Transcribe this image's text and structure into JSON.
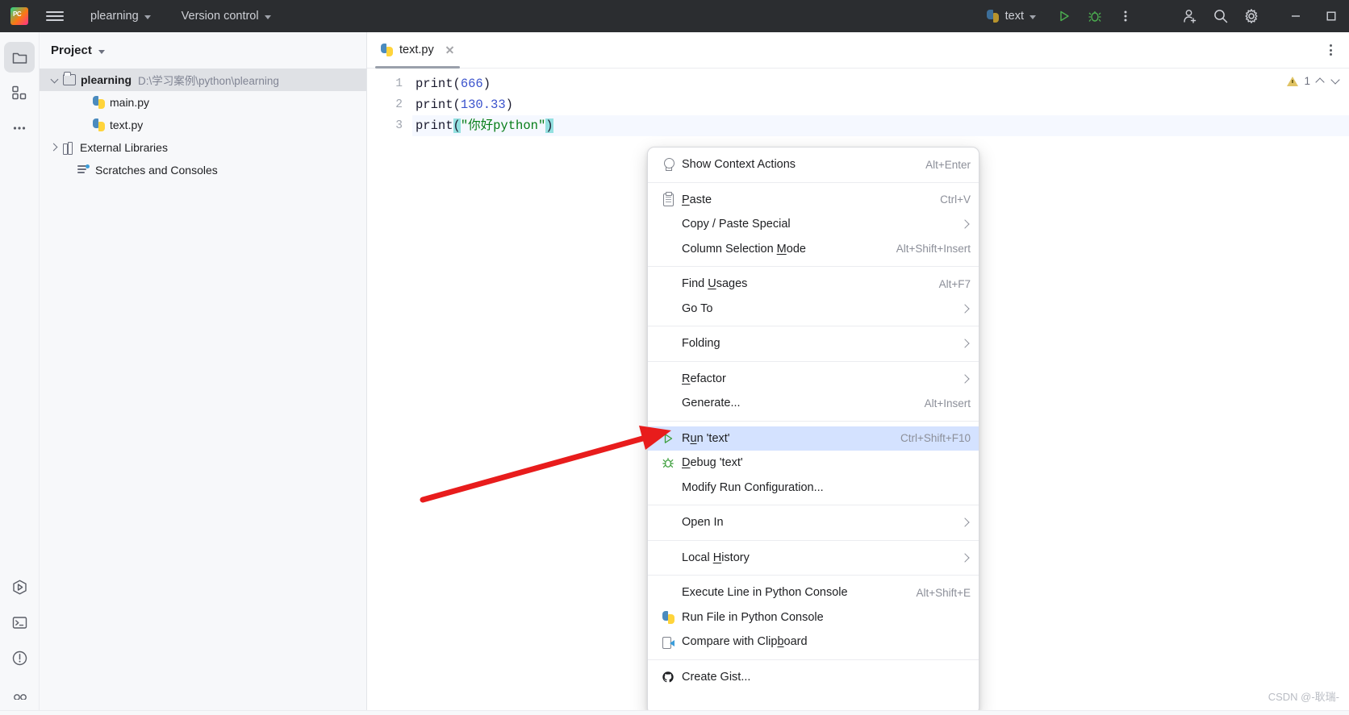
{
  "titlebar": {
    "logo": "pycharm-logo",
    "menu_icon": "hamburger-icon",
    "project_name": "plearning",
    "version_control": "Version control",
    "run_config_name": "text",
    "run_icon": "run-icon",
    "debug_icon": "debug-icon",
    "more_icon": "more-vertical-icon",
    "account_icon": "add-user-icon",
    "search_icon": "search-icon",
    "settings_icon": "gear-icon",
    "minimize_icon": "minimize-icon",
    "maximize_icon": "maximize-icon"
  },
  "rail": {
    "top": [
      {
        "name": "project-tool-icon",
        "active": true
      },
      {
        "name": "structure-tool-icon",
        "active": false
      },
      {
        "name": "more-tools-icon",
        "active": false
      }
    ],
    "bottom": [
      {
        "name": "run-tool-icon"
      },
      {
        "name": "terminal-tool-icon"
      },
      {
        "name": "problems-tool-icon"
      },
      {
        "name": "profiler-tool-icon"
      }
    ]
  },
  "project_panel": {
    "title": "Project",
    "tree": [
      {
        "label": "plearning",
        "path": "D:\\学习案例\\python\\plearning",
        "icon": "folder-icon",
        "arrow": "open",
        "depth": 0,
        "selected": true,
        "bold": true
      },
      {
        "label": "main.py",
        "path": "",
        "icon": "python-file-icon",
        "arrow": "none",
        "depth": 2,
        "selected": false,
        "bold": false
      },
      {
        "label": "text.py",
        "path": "",
        "icon": "python-file-icon",
        "arrow": "none",
        "depth": 2,
        "selected": false,
        "bold": false
      },
      {
        "label": "External Libraries",
        "path": "",
        "icon": "library-icon",
        "arrow": "closed",
        "depth": 0,
        "selected": false,
        "bold": false
      },
      {
        "label": "Scratches and Consoles",
        "path": "",
        "icon": "scratches-icon",
        "arrow": "none",
        "depth": 1,
        "selected": false,
        "bold": false
      }
    ]
  },
  "editor": {
    "tab": {
      "label": "text.py",
      "icon": "python-file-icon",
      "close": "close-icon"
    },
    "tab_more_icon": "more-vertical-icon",
    "inspection": {
      "warning_count": "1",
      "icon": "warning-triangle-icon",
      "prev_icon": "chevron-up-icon",
      "next_icon": "chevron-down-icon"
    },
    "lines": [
      {
        "no": "1",
        "tokens": [
          {
            "t": "print",
            "c": "kw-fn"
          },
          {
            "t": "(",
            "c": "paren"
          },
          {
            "t": "666",
            "c": "num"
          },
          {
            "t": ")",
            "c": "paren"
          }
        ],
        "current": false
      },
      {
        "no": "2",
        "tokens": [
          {
            "t": "print",
            "c": "kw-fn"
          },
          {
            "t": "(",
            "c": "paren"
          },
          {
            "t": "130.33",
            "c": "num"
          },
          {
            "t": ")",
            "c": "paren"
          }
        ],
        "current": false
      },
      {
        "no": "3",
        "tokens": [
          {
            "t": "print",
            "c": "kw-fn"
          },
          {
            "t": "(",
            "c": "paren-hl"
          },
          {
            "t": "\"你好python\"",
            "c": "str"
          },
          {
            "t": ")",
            "c": "paren-hl"
          }
        ],
        "current": true
      }
    ]
  },
  "context_menu": {
    "items": [
      {
        "type": "item",
        "label": "Show Context Actions",
        "shortcut": "Alt+Enter",
        "icon": "lightbulb-icon",
        "submenu": false,
        "selected": false,
        "mnemonic": null
      },
      {
        "type": "sep"
      },
      {
        "type": "item",
        "label": "Paste",
        "shortcut": "Ctrl+V",
        "icon": "clipboard-icon",
        "submenu": false,
        "selected": false,
        "mnemonic": "P"
      },
      {
        "type": "item",
        "label": "Copy / Paste Special",
        "shortcut": "",
        "icon": null,
        "submenu": true,
        "selected": false,
        "mnemonic": null
      },
      {
        "type": "item",
        "label": "Column Selection Mode",
        "shortcut": "Alt+Shift+Insert",
        "icon": null,
        "submenu": false,
        "selected": false,
        "mnemonic": "M"
      },
      {
        "type": "sep"
      },
      {
        "type": "item",
        "label": "Find Usages",
        "shortcut": "Alt+F7",
        "icon": null,
        "submenu": false,
        "selected": false,
        "mnemonic": "U"
      },
      {
        "type": "item",
        "label": "Go To",
        "shortcut": "",
        "icon": null,
        "submenu": true,
        "selected": false,
        "mnemonic": null
      },
      {
        "type": "sep"
      },
      {
        "type": "item",
        "label": "Folding",
        "shortcut": "",
        "icon": null,
        "submenu": true,
        "selected": false,
        "mnemonic": null
      },
      {
        "type": "sep"
      },
      {
        "type": "item",
        "label": "Refactor",
        "shortcut": "",
        "icon": null,
        "submenu": true,
        "selected": false,
        "mnemonic": "R"
      },
      {
        "type": "item",
        "label": "Generate...",
        "shortcut": "Alt+Insert",
        "icon": null,
        "submenu": false,
        "selected": false,
        "mnemonic": null
      },
      {
        "type": "sep"
      },
      {
        "type": "item",
        "label": "Run 'text'",
        "shortcut": "Ctrl+Shift+F10",
        "icon": "run-green-icon",
        "submenu": false,
        "selected": true,
        "mnemonic": "u"
      },
      {
        "type": "item",
        "label": "Debug 'text'",
        "shortcut": "",
        "icon": "debug-green-icon",
        "submenu": false,
        "selected": false,
        "mnemonic": "D"
      },
      {
        "type": "item",
        "label": "Modify Run Configuration...",
        "shortcut": "",
        "icon": null,
        "submenu": false,
        "selected": false,
        "mnemonic": null
      },
      {
        "type": "sep"
      },
      {
        "type": "item",
        "label": "Open In",
        "shortcut": "",
        "icon": null,
        "submenu": true,
        "selected": false,
        "mnemonic": null
      },
      {
        "type": "sep"
      },
      {
        "type": "item",
        "label": "Local History",
        "shortcut": "",
        "icon": null,
        "submenu": true,
        "selected": false,
        "mnemonic": "H"
      },
      {
        "type": "sep"
      },
      {
        "type": "item",
        "label": "Execute Line in Python Console",
        "shortcut": "Alt+Shift+E",
        "icon": null,
        "submenu": false,
        "selected": false,
        "mnemonic": null
      },
      {
        "type": "item",
        "label": "Run File in Python Console",
        "shortcut": "",
        "icon": "python-file-icon",
        "submenu": false,
        "selected": false,
        "mnemonic": null
      },
      {
        "type": "item",
        "label": "Compare with Clipboard",
        "shortcut": "",
        "icon": "compare-clipboard-icon",
        "submenu": false,
        "selected": false,
        "mnemonic": "b"
      },
      {
        "type": "sep"
      },
      {
        "type": "item",
        "label": "Create Gist...",
        "shortcut": "",
        "icon": "github-icon",
        "submenu": false,
        "selected": false,
        "mnemonic": null
      }
    ]
  },
  "annotation": {
    "arrow_color": "#e81c1c",
    "arrow_name": "red-pointer-arrow"
  },
  "watermark": {
    "text": "CSDN @-耿瑞-"
  },
  "colors": {
    "titlebar_bg": "#2b2d30",
    "panel_bg": "#f7f8fa",
    "editor_bg": "#ffffff",
    "selection_blue": "#d4e2ff",
    "string_green": "#067d17",
    "number_blue": "#3a52cc",
    "paren_highlight": "#93e0e0"
  }
}
